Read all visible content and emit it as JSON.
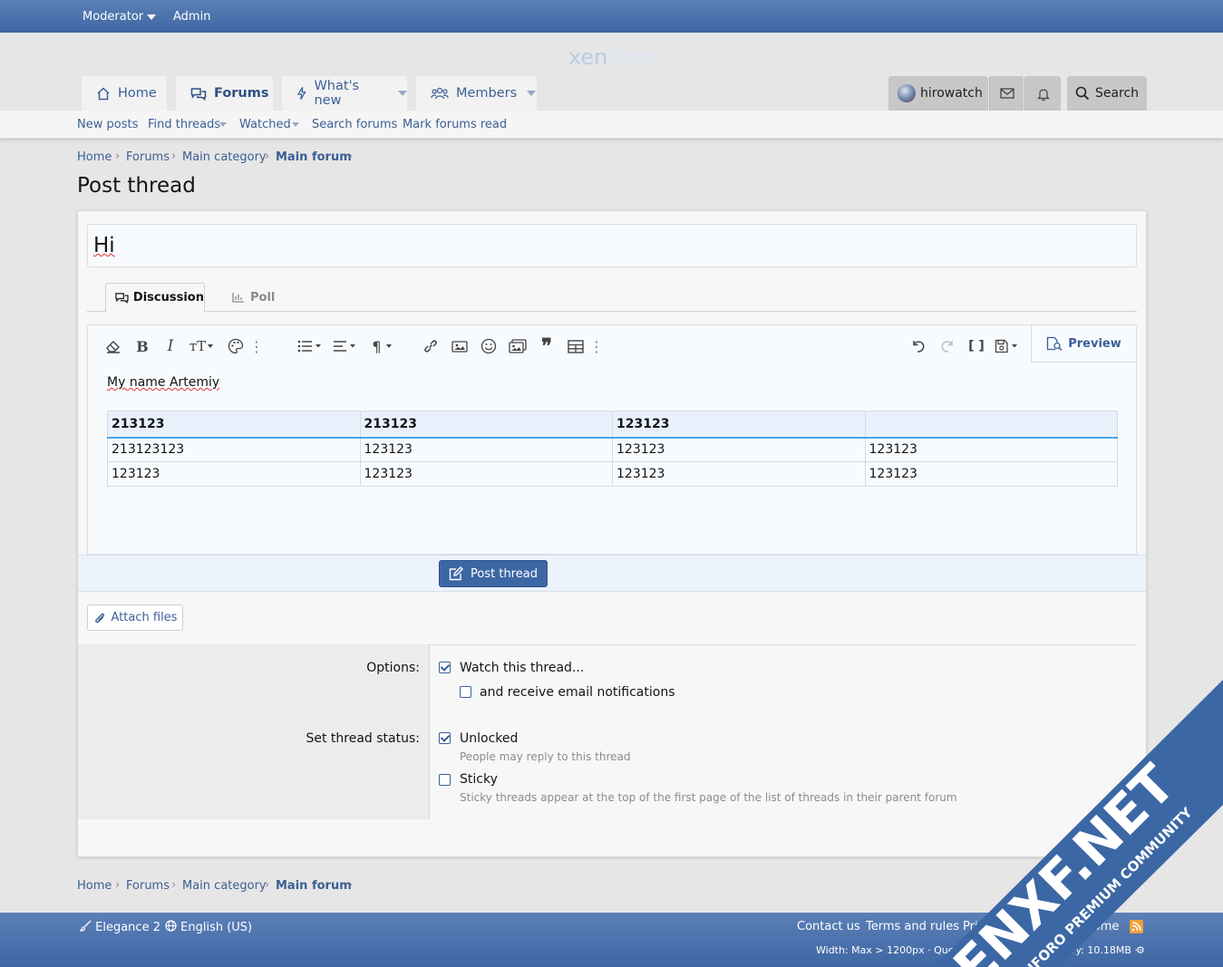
{
  "topbar": {
    "moderator": "Moderator",
    "admin": "Admin"
  },
  "logo": {
    "text_a": "xen",
    "text_b": "Foro"
  },
  "nav": {
    "home": "Home",
    "forums": "Forums",
    "whats_new": "What's new",
    "members": "Members",
    "username": "hirowatch",
    "search": "Search"
  },
  "subnav": {
    "new_posts": "New posts",
    "find_threads": "Find threads",
    "watched": "Watched",
    "search_forums": "Search forums",
    "mark_read": "Mark forums read"
  },
  "breadcrumb": [
    "Home",
    "Forums",
    "Main category",
    "Main forum"
  ],
  "page_title": "Post thread",
  "thread_title_value": "Hi",
  "tabs": {
    "discussion": "Discussion",
    "poll": "Poll"
  },
  "editor": {
    "preview": "Preview",
    "paragraph": "My name Artemiy",
    "table": {
      "header": [
        "213123",
        "213123",
        "123123",
        ""
      ],
      "rows": [
        [
          "213123123",
          "123123",
          "123123",
          "123123"
        ],
        [
          "123123",
          "123123",
          "123123",
          "123123"
        ]
      ]
    }
  },
  "submit_label": "Post thread",
  "attach_label": "Attach files",
  "options": {
    "options_label": "Options:",
    "watch": "Watch this thread...",
    "email": "and receive email notifications",
    "status_label": "Set thread status:",
    "unlocked": "Unlocked",
    "unlocked_hint": "People may reply to this thread",
    "sticky": "Sticky",
    "sticky_hint": "Sticky threads appear at the top of the first page of the list of threads in their parent forum"
  },
  "footer": {
    "style": "Elegance 2",
    "language": "English (US)",
    "contact": "Contact us",
    "terms": "Terms and rules",
    "privacy": "Pri",
    "help": "elp",
    "home": "Home",
    "debug_left": "Width: Max > 1200px · Queri",
    "debug_right": "9s · Memory: 10.18MB ·"
  },
  "watermark": {
    "line1": "ENXF.NET",
    "line2": "XENFORO PREMIUM COMMUNITY"
  },
  "colors": {
    "brand": "#3f67a3",
    "link": "#3b5f95",
    "accent": "#47a7eb",
    "watermark": "#3c67a5"
  }
}
